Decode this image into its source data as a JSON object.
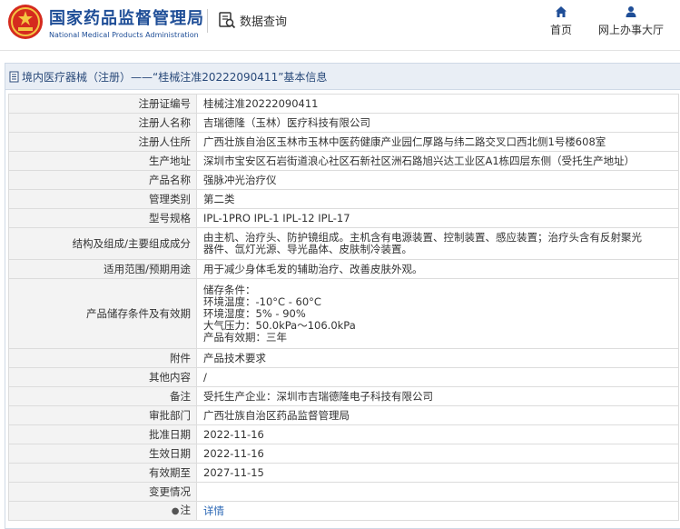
{
  "header": {
    "title_cn": "国家药品监督管理局",
    "title_en": "National Medical Products Administration",
    "data_query": "数据查询",
    "nav_home": "首页",
    "nav_online": "网上办事大厅"
  },
  "breadcrumb": "境内医疗器械（注册）——“桂械注准20222090411”基本信息",
  "rows": [
    {
      "k": "注册证编号",
      "v": "桂械注准20222090411"
    },
    {
      "k": "注册人名称",
      "v": "吉瑞德隆（玉林）医疗科技有限公司"
    },
    {
      "k": "注册人住所",
      "v": "广西壮族自治区玉林市玉林中医药健康产业园仁厚路与纬二路交叉口西北侧1号楼608室"
    },
    {
      "k": "生产地址",
      "v": "深圳市宝安区石岩街道浪心社区石新社区洲石路旭兴达工业区A1栋四层东侧（受托生产地址）"
    },
    {
      "k": "产品名称",
      "v": "强脉冲光治疗仪"
    },
    {
      "k": "管理类别",
      "v": "第二类"
    },
    {
      "k": "型号规格",
      "v": "IPL-1PRO IPL-1 IPL-12 IPL-17"
    },
    {
      "k": "结构及组成/主要组成成分",
      "v1": "由主机、治疗头、防护镜组成。主机含有电源装置、控制装置、感应装置；治疗头含有反射聚光",
      "v2": "器件、氙灯光源、导光晶体、皮肤制冷装置。"
    },
    {
      "k": "适用范围/预期用途",
      "v": "用于减少身体毛发的辅助治疗、改善皮肤外观。"
    },
    {
      "k": "产品储存条件及有效期",
      "lines": [
        "储存条件：",
        "环境温度：-10°C - 60°C",
        "环境湿度：5% - 90%",
        "大气压力：50.0kPa～106.0kPa",
        "产品有效期：三年"
      ]
    },
    {
      "k": "附件",
      "v": "产品技术要求"
    },
    {
      "k": "其他内容",
      "v": "/"
    },
    {
      "k": "备注",
      "v": "受托生产企业：深圳市吉瑞德隆电子科技有限公司"
    },
    {
      "k": "审批部门",
      "v": "广西壮族自治区药品监督管理局"
    },
    {
      "k": "批准日期",
      "v": "2022-11-16"
    },
    {
      "k": "生效日期",
      "v": "2022-11-16"
    },
    {
      "k": "有效期至",
      "v": "2027-11-15"
    },
    {
      "k": "变更情况",
      "v": ""
    },
    {
      "k": "注",
      "v": "详情"
    }
  ],
  "colors": {
    "brand": "#1f4e97",
    "link": "#2a67b5",
    "title_bg": "#e9eef5",
    "label_bg": "#f3f3f3"
  }
}
